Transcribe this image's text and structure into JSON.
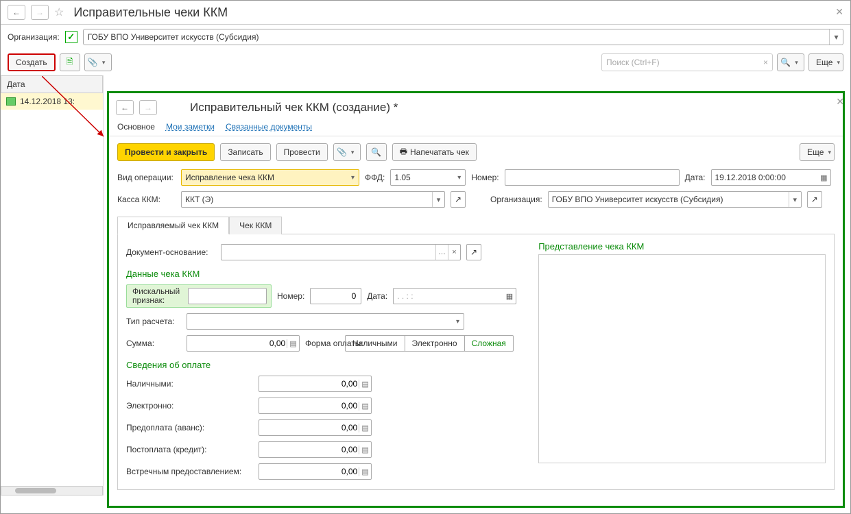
{
  "main": {
    "title": "Исправительные чеки ККМ",
    "org_label": "Организация:",
    "org_value": "ГОБУ ВПО Университет искусств (Субсидия)",
    "create_btn": "Создать",
    "search_placeholder": "Поиск (Ctrl+F)",
    "more_btn": "Еще",
    "date_header": "Дата",
    "list_row_date": "14.12.2018 13:"
  },
  "detail": {
    "title": "Исправительный чек ККМ (создание) *",
    "tabs": {
      "main": "Основное",
      "notes": "Мои заметки",
      "related": "Связанные документы"
    },
    "buttons": {
      "post_close": "Провести и закрыть",
      "save": "Записать",
      "post": "Провести",
      "print": "Напечатать чек",
      "more": "Еще"
    },
    "fields": {
      "vid_label": "Вид операции:",
      "vid_value": "Исправление чека ККМ",
      "ffd_label": "ФФД:",
      "ffd_value": "1.05",
      "number_label": "Номер:",
      "number_value": "",
      "date_label": "Дата:",
      "date_value": "19.12.2018  0:00:00",
      "kassa_label": "Касса ККМ:",
      "kassa_value": "ККТ (Э)",
      "org_label": "Организация:",
      "org_value": "ГОБУ ВПО Университет искусств (Субсидия)"
    },
    "subtabs": {
      "corrected": "Исправляемый чек ККМ",
      "chek": "Чек ККМ"
    },
    "doc_basis_label": "Документ-основание:",
    "section_data": "Данные чека ККМ",
    "section_preview": "Представление чека ККМ",
    "fiscal_label": "Фискальный признак:",
    "check_number_label": "Номер:",
    "check_number_value": "0",
    "check_date_label": "Дата:",
    "check_date_value": "  .  .       :  :",
    "tip_rascheta_label": "Тип расчета:",
    "summa_label": "Сумма:",
    "summa_value": "0,00",
    "forma_oplaty_label": "Форма оплаты:",
    "payment_seg": {
      "cash": "Наличными",
      "electronic": "Электронно",
      "complex": "Сложная"
    },
    "section_payment": "Сведения об оплате",
    "pay_cash_label": "Наличными:",
    "pay_electronic_label": "Электронно:",
    "pay_prepaid_label": "Предоплата (аванс):",
    "pay_postpaid_label": "Постоплата (кредит):",
    "pay_counter_label": "Встречным предоставлением:",
    "zero": "0,00"
  }
}
